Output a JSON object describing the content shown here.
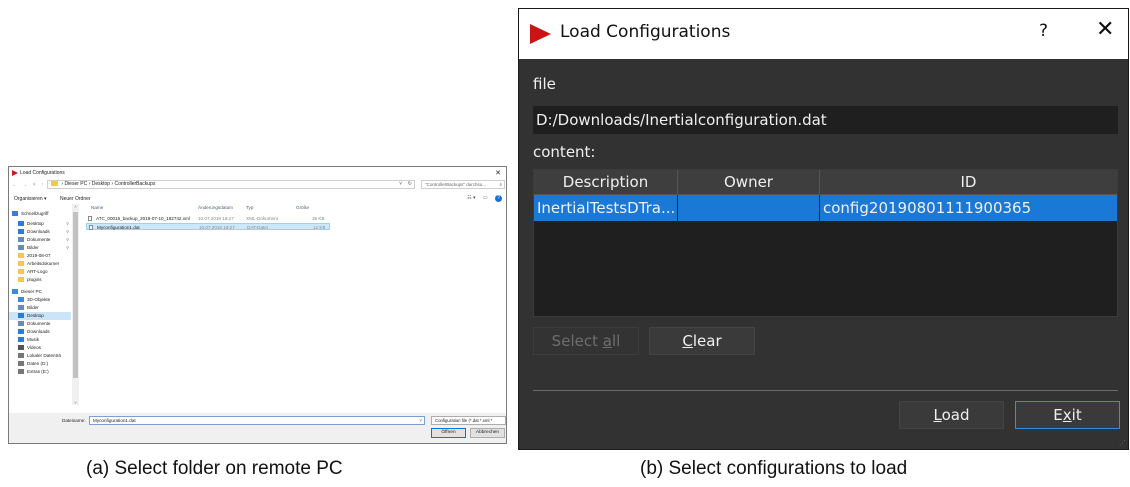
{
  "panel_a": {
    "window_title": "Load Configurations",
    "address_parts": [
      "Dieser PC",
      "Desktop",
      "ControllerBackups"
    ],
    "search_placeholder": "\"ControllerBackups\" durchsu...",
    "toolbar": {
      "organize": "Organisieren ▾",
      "new_folder": "Neuer Ordner"
    },
    "nav_tree": [
      {
        "label": "Schnellzugriff",
        "icon": "star-icon",
        "color": "#3a7bd5"
      },
      {
        "label": "Desktop",
        "icon": "desktop-icon",
        "color": "#2b7cd3",
        "pinned": true
      },
      {
        "label": "Downloads",
        "icon": "download-icon",
        "color": "#2b7cd3",
        "pinned": true
      },
      {
        "label": "Dokumente",
        "icon": "document-icon",
        "color": "#6a8bb5",
        "pinned": true
      },
      {
        "label": "Bilder",
        "icon": "picture-icon",
        "color": "#6a8bb5",
        "pinned": true
      },
      {
        "label": "2019-08-07",
        "icon": "folder-icon",
        "color": "#f4c84f"
      },
      {
        "label": "Arbeitsdokumer",
        "icon": "folder-icon",
        "color": "#f4c84f"
      },
      {
        "label": "ART-Logo",
        "icon": "folder-icon",
        "color": "#f4c84f"
      },
      {
        "label": "plugins",
        "icon": "folder-icon",
        "color": "#f4c84f"
      },
      {
        "label": "Dieser PC",
        "icon": "computer-icon",
        "color": "#3c8ad8"
      },
      {
        "label": "3D-Objekte",
        "icon": "cube-icon",
        "color": "#3c8ad8"
      },
      {
        "label": "Bilder",
        "icon": "picture-icon",
        "color": "#6a8bb5"
      },
      {
        "label": "Desktop",
        "icon": "desktop-icon",
        "color": "#2b7cd3",
        "selected": true
      },
      {
        "label": "Dokumente",
        "icon": "document-icon",
        "color": "#6a8bb5"
      },
      {
        "label": "Downloads",
        "icon": "download-icon",
        "color": "#2b7cd3"
      },
      {
        "label": "Musik",
        "icon": "music-icon",
        "color": "#2b7cd3"
      },
      {
        "label": "Videos",
        "icon": "video-icon",
        "color": "#555555"
      },
      {
        "label": "Lokaler Datenträ",
        "icon": "drive-icon",
        "color": "#777777"
      },
      {
        "label": "Daten (D:)",
        "icon": "drive-icon",
        "color": "#777777"
      },
      {
        "label": "Extras (E:)",
        "icon": "drive-icon",
        "color": "#777777"
      }
    ],
    "columns": [
      "Name",
      "Änderungsdatum",
      "Typ",
      "Größe"
    ],
    "files": [
      {
        "name": "ATC_00015_backup_2019-07-10_182742.xml",
        "date": "10.07.2019 18:27",
        "type": "XML-Dokument",
        "size": "39 KB",
        "selected": false
      },
      {
        "name": "Myconfiguration1.dat",
        "date": "10.07.2019 18:27",
        "type": "DAT-Datei",
        "size": "12 KB",
        "selected": true
      }
    ],
    "filename_label": "Dateiname:",
    "filename_value": "Myconfiguration1.dat",
    "filetype_value": "Configuration file (*.dat *.xml *",
    "open_label": "Öffnen",
    "cancel_label": "Abbrechen"
  },
  "panel_b": {
    "window_title": "Load Configurations",
    "help_glyph": "?",
    "close_glyph": "✕",
    "file_label": "file",
    "file_path": "D:/Downloads/Inertialconfiguration.dat",
    "content_label": "content:",
    "columns": [
      "Description",
      "Owner",
      "ID"
    ],
    "rows": [
      {
        "description": "InertialTestsDTra...",
        "owner": "",
        "id": "config20190801111900365",
        "selected": true
      }
    ],
    "select_all_label": "Select all",
    "clear_label": "Clear",
    "load_label": "Load",
    "exit_label": "Exit"
  },
  "captions": {
    "a": "(a) Select folder on remote PC",
    "b": "(b) Select configurations to load"
  }
}
